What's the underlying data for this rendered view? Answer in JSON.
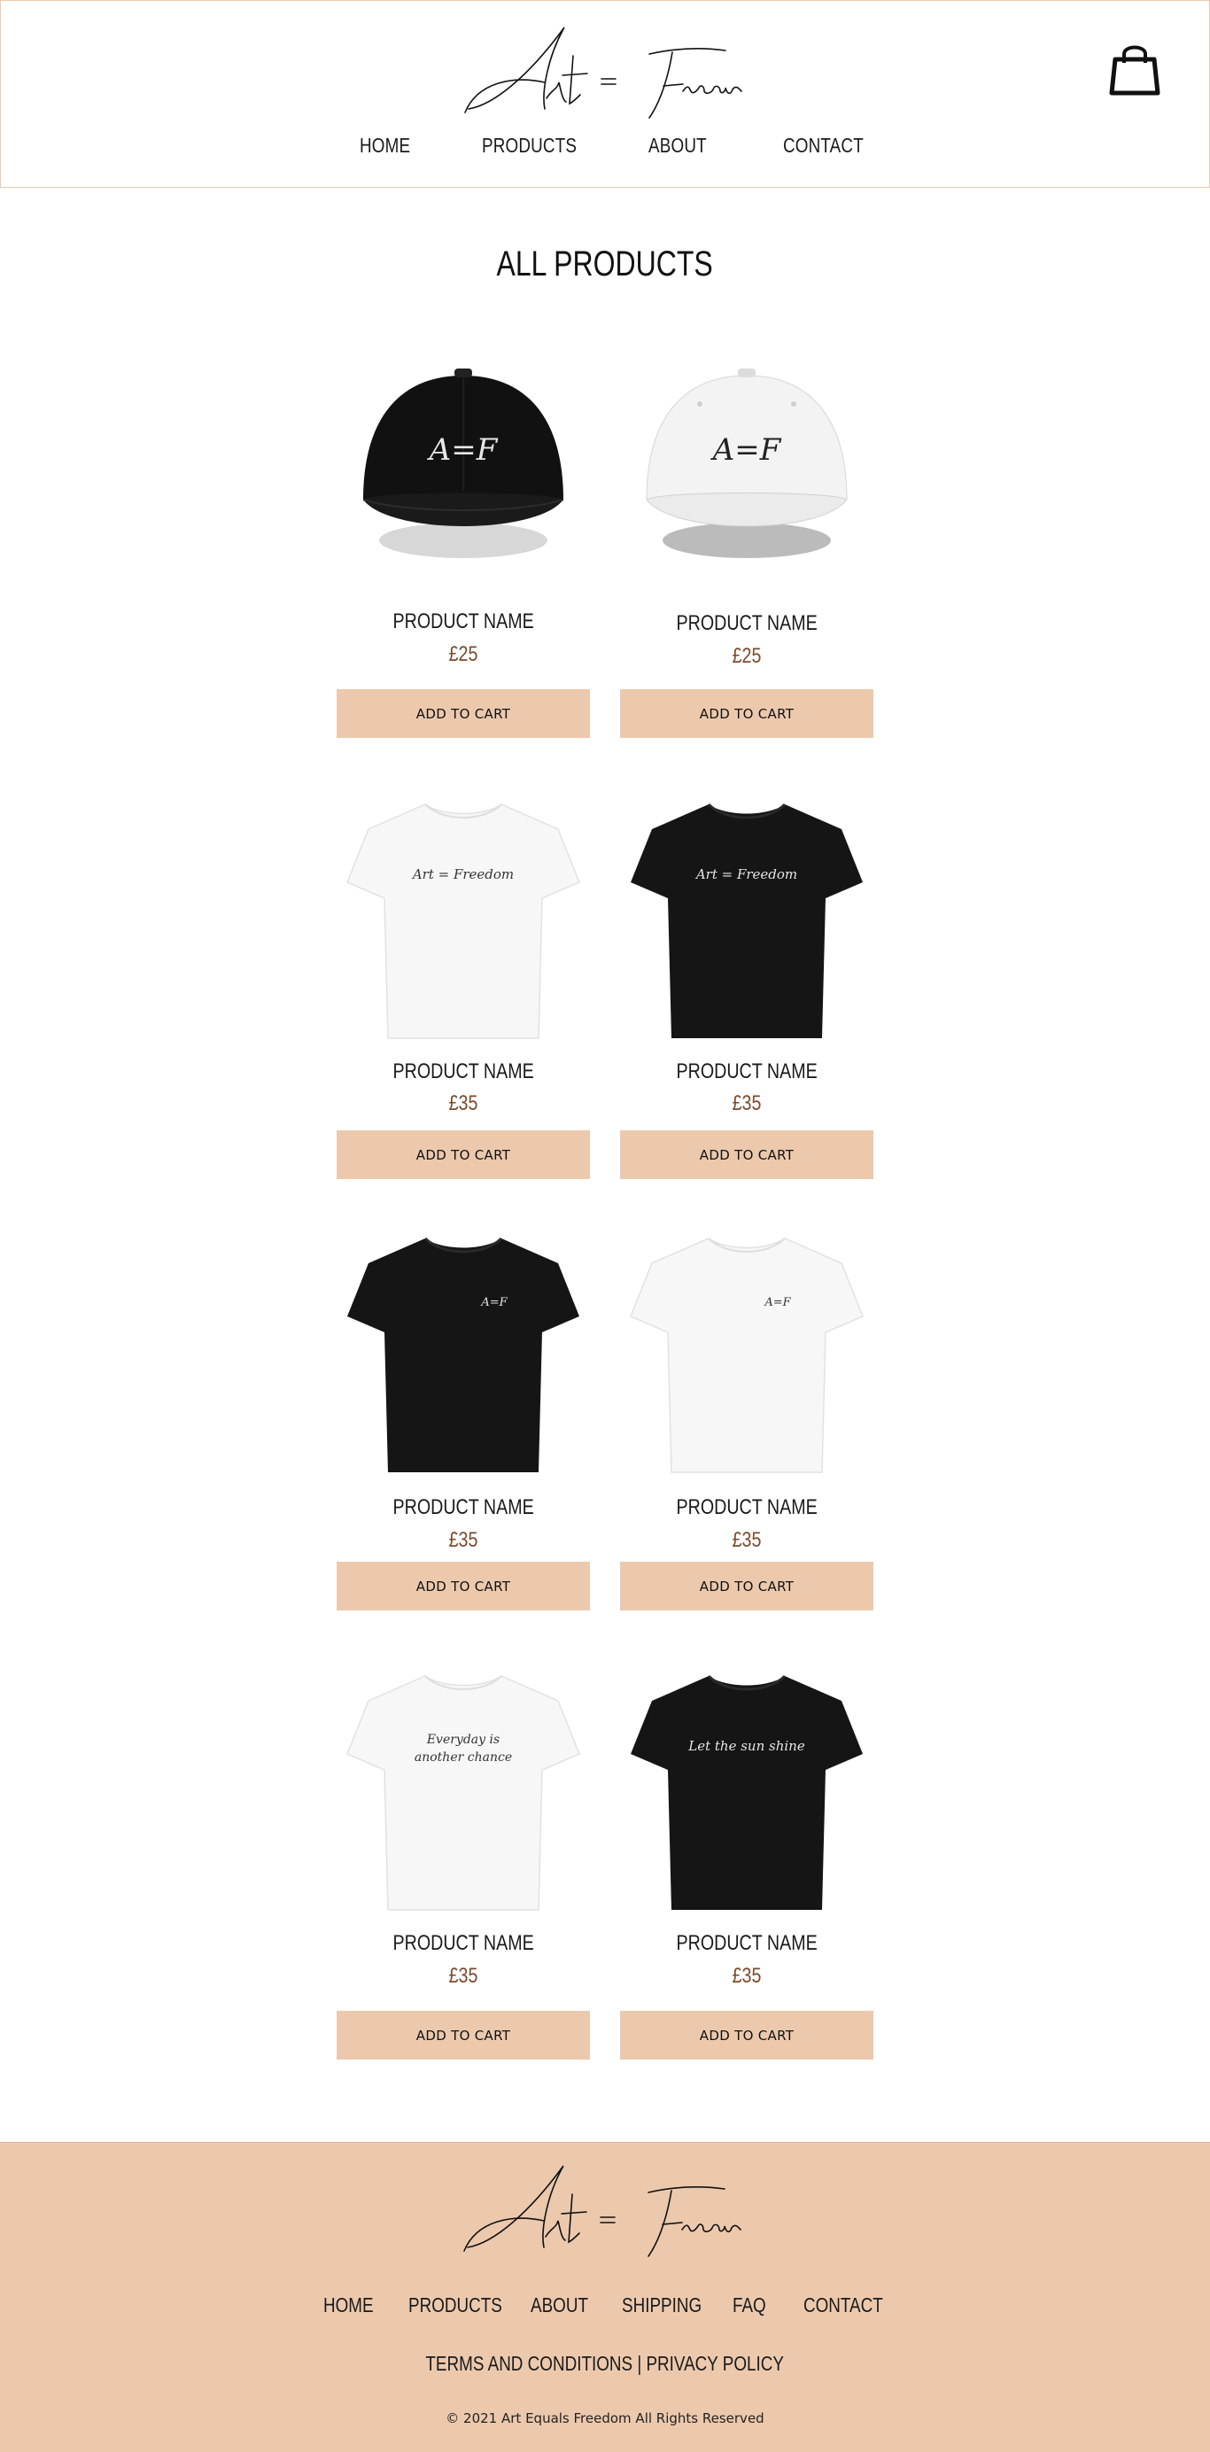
{
  "header": {
    "logo_text": "Art = Freedom",
    "cart_icon": "shopping-bag-icon",
    "nav": [
      "HOME",
      "PRODUCTS",
      "ABOUT",
      "CONTACT"
    ]
  },
  "page_title": "ALL PRODUCTS",
  "colors": {
    "accent": "#ecc9ad",
    "price": "#7a4a2e",
    "text": "#111111"
  },
  "products": [
    {
      "name": "PRODUCT NAME",
      "price": "£25",
      "button": "ADD TO CART",
      "image": "black-cap",
      "print": "A=F"
    },
    {
      "name": "PRODUCT NAME",
      "price": "£25",
      "button": "ADD TO CART",
      "image": "white-cap",
      "print": "A=F"
    },
    {
      "name": "PRODUCT NAME",
      "price": "£35",
      "button": "ADD TO CART",
      "image": "white-tshirt",
      "print": "Art = Freedom"
    },
    {
      "name": "PRODUCT NAME",
      "price": "£35",
      "button": "ADD TO CART",
      "image": "black-tshirt",
      "print": "Art = Freedom"
    },
    {
      "name": "PRODUCT NAME",
      "price": "£35",
      "button": "ADD TO CART",
      "image": "black-tshirt",
      "print": "A=F"
    },
    {
      "name": "PRODUCT NAME",
      "price": "£35",
      "button": "ADD TO CART",
      "image": "white-tshirt",
      "print": "A=F"
    },
    {
      "name": "PRODUCT NAME",
      "price": "£35",
      "button": "ADD TO CART",
      "image": "white-tshirt",
      "print": "Everyday is another chance"
    },
    {
      "name": "PRODUCT NAME",
      "price": "£35",
      "button": "ADD TO CART",
      "image": "black-tshirt",
      "print": "Let the sun shine"
    }
  ],
  "footer": {
    "logo_text": "Art = Freedom",
    "nav": [
      "HOME",
      "PRODUCTS",
      "ABOUT",
      "SHIPPING",
      "FAQ",
      "CONTACT"
    ],
    "terms": "TERMS AND CONDITIONS",
    "separator": "|",
    "privacy": "PRIVACY POLICY",
    "copyright": "© 2021 Art Equals Freedom All Rights Reserved"
  }
}
